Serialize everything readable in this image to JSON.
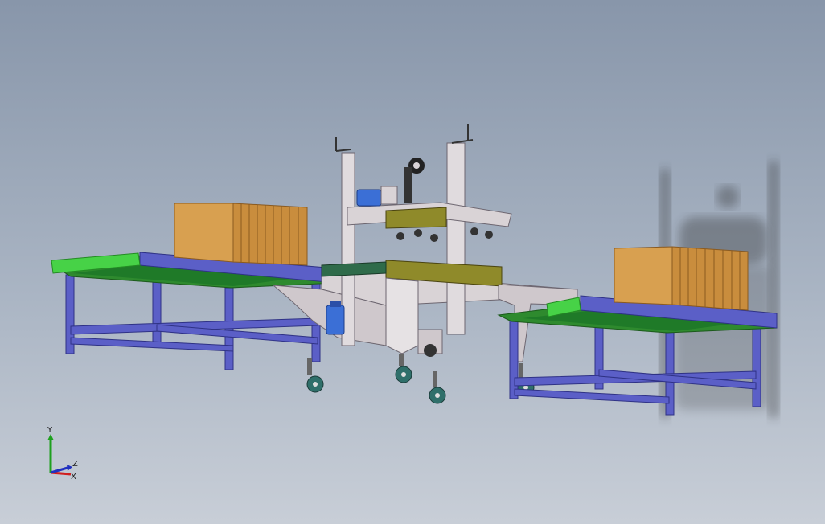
{
  "viewport": {
    "background_top": "#8896aa",
    "background_bottom": "#c8ced7"
  },
  "colors": {
    "frame": "#5b5fc7",
    "frame_dark": "#3f43a0",
    "belt": "#3fd13f",
    "belt_dark": "#2a8a2a",
    "carton": "#d8a050",
    "carton_side": "#c98d3d",
    "machine": "#d9d3d6",
    "machine_shade": "#b9b1b6",
    "tape_head": "#8f8a2a",
    "motor": "#3b6fd6",
    "wheel": "#2f6f6a"
  },
  "triad": {
    "x_label": "X",
    "y_label": "Y",
    "z_label": "Z"
  }
}
